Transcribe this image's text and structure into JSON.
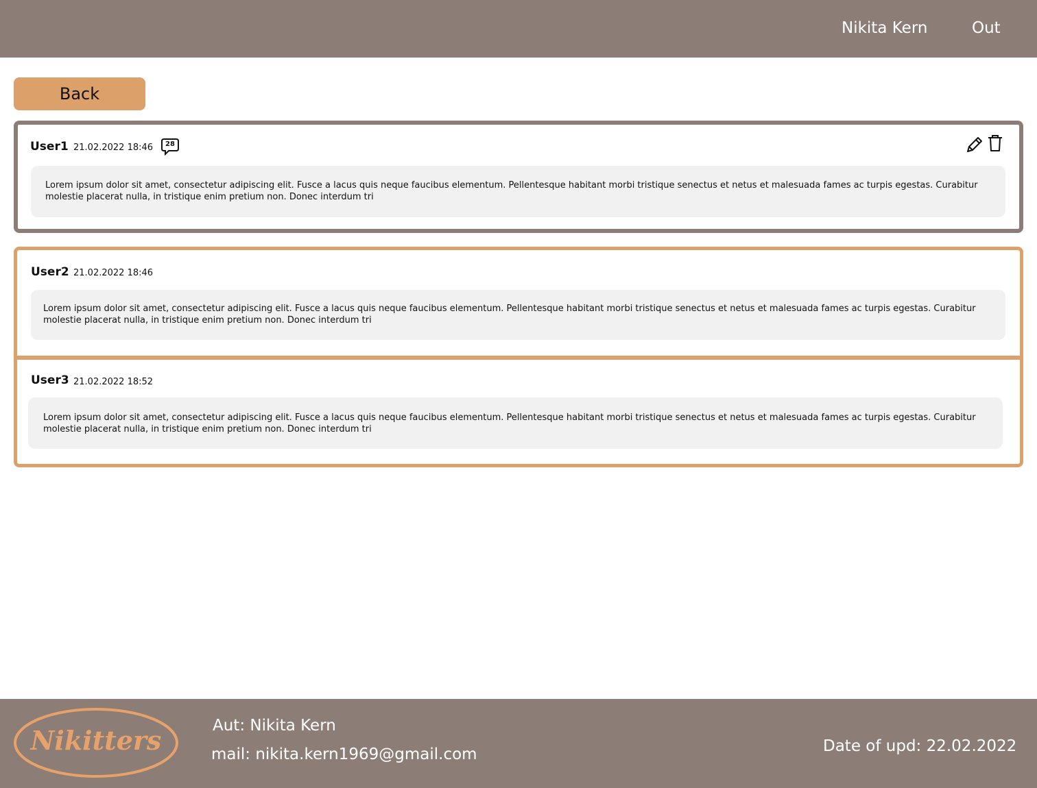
{
  "header": {
    "user_name": "Nikita Kern",
    "logout_label": "Out"
  },
  "navigation": {
    "back_label": "Back"
  },
  "post": {
    "author": "User1",
    "timestamp": "21.02.2022 18:46",
    "comment_count": "28",
    "text": "Lorem ipsum dolor sit amet, consectetur adipiscing elit. Fusce a lacus quis neque faucibus elementum. Pellentesque habitant morbi tristique senectus et netus et malesuada fames ac turpis egestas. Curabitur molestie placerat nulla, in tristique enim pretium non. Donec interdum tri",
    "actions": {
      "edit_icon": "pencil-icon",
      "delete_icon": "trash-icon"
    }
  },
  "comments": [
    {
      "author": "User2",
      "timestamp": "21.02.2022 18:46",
      "text": "Lorem ipsum dolor sit amet, consectetur adipiscing elit. Fusce a lacus quis neque faucibus elementum. Pellentesque habitant morbi tristique senectus et netus et malesuada fames ac turpis egestas. Curabitur molestie placerat nulla, in tristique enim pretium non. Donec interdum tri"
    },
    {
      "author": "User3",
      "timestamp": "21.02.2022 18:52",
      "text": "Lorem ipsum dolor sit amet, consectetur adipiscing elit. Fusce a lacus quis neque faucibus elementum. Pellentesque habitant morbi tristique senectus et netus et malesuada fames ac turpis egestas. Curabitur molestie placerat nulla, in tristique enim pretium non. Donec interdum tri"
    }
  ],
  "footer": {
    "logo_text": "Nikitters",
    "author_line": "Aut: Nikita Kern",
    "mail_line": "mail: nikita.kern1969@gmail.com",
    "date_line": "Date of upd: 22.02.2022"
  },
  "colors": {
    "header_footer_bg": "#8c7e76",
    "accent_orange": "#dca06a",
    "message_bg": "#f1f1f1"
  }
}
